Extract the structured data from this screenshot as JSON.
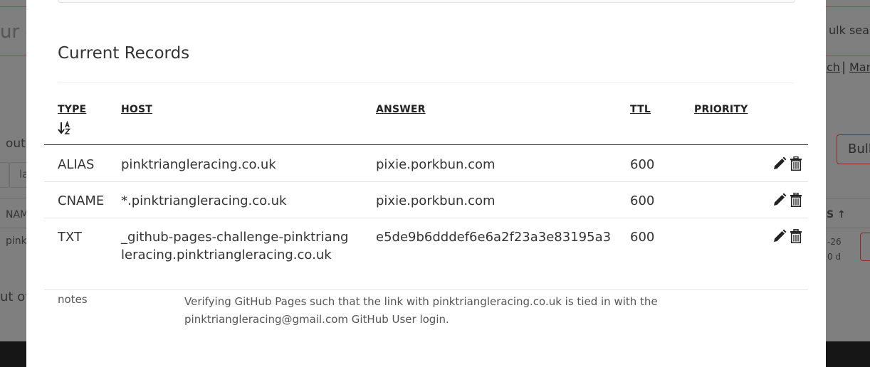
{
  "background": {
    "left_fragment_search": "ur c",
    "right_fragment_search": "ulk search",
    "link_fragment_1": "ch",
    "link_separator": "|",
    "link_fragment_2": "Mar",
    "left_fragment_out": "out",
    "left_fragment_la": "la",
    "bulk_button_fragment": "Bull",
    "column_fragment_name": "NAM",
    "column_fragment_sort": "S ↑",
    "row_fragment_pink": "pink",
    "row_fragment_date": "-26",
    "row_fragment_days": "0 d",
    "left_fragment_out_of": "ut of"
  },
  "modal": {
    "title": "Current Records",
    "columns": {
      "type": "TYPE",
      "host": "HOST",
      "answer": "ANSWER",
      "ttl": "TTL",
      "priority": "PRIORITY"
    },
    "records": [
      {
        "type": "ALIAS",
        "host": "pinktriangleracing.co.uk",
        "answer": "pixie.porkbun.com",
        "ttl": "600",
        "priority": ""
      },
      {
        "type": "CNAME",
        "host": "*.pinktriangleracing.co.uk",
        "answer": "pixie.porkbun.com",
        "ttl": "600",
        "priority": ""
      },
      {
        "type": "TXT",
        "host": "_github-pages-challenge-pinktriangleracing.pinktriangleracing.co.uk",
        "answer": "e5de9b6dddef6e6a2f23a3e83195a3",
        "ttl": "600",
        "priority": ""
      }
    ],
    "notes": {
      "label": "notes",
      "text": "Verifying GitHub Pages such that the link with pinktriangleracing.co.uk is tied in with the pinktriangleracing@gmail.com GitHub User login."
    },
    "icons": {
      "edit": "pencil-icon",
      "delete": "trash-icon",
      "sort": "sort-alpha-down-icon"
    }
  }
}
